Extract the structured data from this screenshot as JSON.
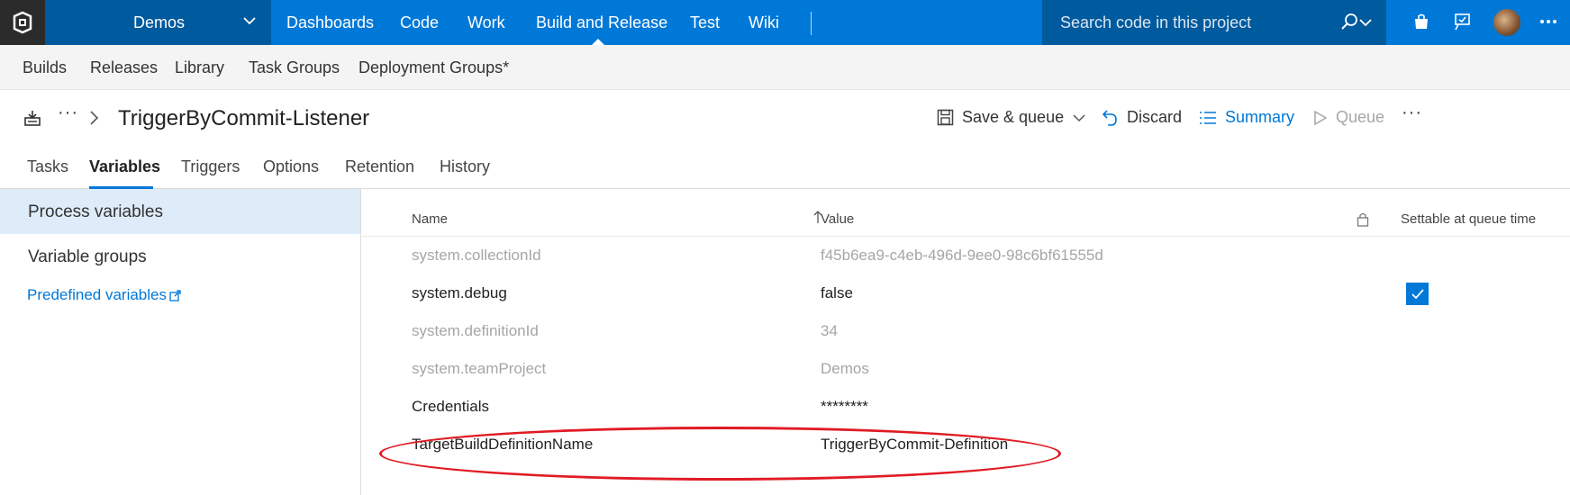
{
  "topbar": {
    "project": "Demos",
    "nav": [
      "Dashboards",
      "Code",
      "Work",
      "Build and Release",
      "Test",
      "Wiki"
    ],
    "active_nav": "Build and Release",
    "search_placeholder": "Search code in this project",
    "colors": {
      "bar": "#0078d7",
      "dark": "#005a9e",
      "logo_bg": "#2b2b2b"
    }
  },
  "subnav": {
    "items": [
      "Builds",
      "Releases",
      "Library",
      "Task Groups",
      "Deployment Groups*"
    ]
  },
  "titlebar": {
    "more": "···",
    "title": "TriggerByCommit-Listener",
    "save_queue": "Save & queue",
    "discard": "Discard",
    "summary": "Summary",
    "queue": "Queue",
    "toolbar_more": "···"
  },
  "tabs": {
    "items": [
      "Tasks",
      "Variables",
      "Triggers",
      "Options",
      "Retention",
      "History"
    ],
    "active": "Variables"
  },
  "leftpane": {
    "process_variables": "Process variables",
    "variable_groups": "Variable groups",
    "predefined_variables": "Predefined variables"
  },
  "table": {
    "headers": {
      "name": "Name",
      "value": "Value",
      "settable": "Settable at queue time"
    },
    "rows": [
      {
        "name": "system.collectionId",
        "value": "f45b6ea9-c4eb-496d-9ee0-98c6bf61555d",
        "muted": true,
        "settable": false
      },
      {
        "name": "system.debug",
        "value": "false",
        "muted": false,
        "settable": true
      },
      {
        "name": "system.definitionId",
        "value": "34",
        "muted": true,
        "settable": false
      },
      {
        "name": "system.teamProject",
        "value": "Demos",
        "muted": true,
        "settable": false
      },
      {
        "name": "Credentials",
        "value": "********",
        "muted": false,
        "settable": false
      },
      {
        "name": "TargetBuildDefinitionName",
        "value": "TriggerByCommit-Definition",
        "muted": false,
        "settable": false,
        "highlighted": true
      }
    ]
  },
  "accent_color": "#0078d7",
  "highlight_color": "#e01b24"
}
